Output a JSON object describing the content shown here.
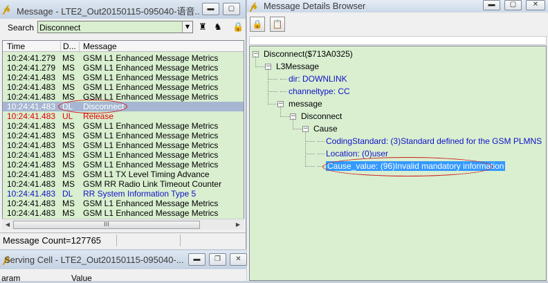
{
  "left_window": {
    "title": "Message - LTE2_Out20150115-095040-语音...",
    "search_label": "Search",
    "search_value": "Disconnect",
    "columns": [
      "Time",
      "D...",
      "Message"
    ],
    "rows": [
      {
        "time": "10:24:41.279",
        "dir": "MS",
        "msg": "GSM L1 Enhanced Message Metrics",
        "color": "#000000"
      },
      {
        "time": "10:24:41.279",
        "dir": "MS",
        "msg": "GSM L1 Enhanced Message Metrics",
        "color": "#000000"
      },
      {
        "time": "10:24:41.483",
        "dir": "MS",
        "msg": "GSM L1 Enhanced Message Metrics",
        "color": "#000000"
      },
      {
        "time": "10:24:41.483",
        "dir": "MS",
        "msg": "GSM L1 Enhanced Message Metrics",
        "color": "#000000"
      },
      {
        "time": "10:24:41.483",
        "dir": "MS",
        "msg": "GSM L1 Enhanced Message Metrics",
        "color": "#000000"
      },
      {
        "time": "10:24:41.483",
        "dir": "DL",
        "msg": "Disconnect",
        "color": "#ffffff"
      },
      {
        "time": "10:24:41.483",
        "dir": "UL",
        "msg": "Release",
        "color": "#e00000"
      },
      {
        "time": "10:24:41.483",
        "dir": "MS",
        "msg": "GSM L1 Enhanced Message Metrics",
        "color": "#000000"
      },
      {
        "time": "10:24:41.483",
        "dir": "MS",
        "msg": "GSM L1 Enhanced Message Metrics",
        "color": "#000000"
      },
      {
        "time": "10:24:41.483",
        "dir": "MS",
        "msg": "GSM L1 Enhanced Message Metrics",
        "color": "#000000"
      },
      {
        "time": "10:24:41.483",
        "dir": "MS",
        "msg": "GSM L1 Enhanced Message Metrics",
        "color": "#000000"
      },
      {
        "time": "10:24:41.483",
        "dir": "MS",
        "msg": "GSM L1 Enhanced Message Metrics",
        "color": "#000000"
      },
      {
        "time": "10:24:41.483",
        "dir": "MS",
        "msg": "GSM L1 TX Level Timing Advance",
        "color": "#000000"
      },
      {
        "time": "10:24:41.483",
        "dir": "MS",
        "msg": "GSM RR Radio Link Timeout Counter",
        "color": "#000000"
      },
      {
        "time": "10:24:41.483",
        "dir": "DL",
        "msg": "RR System Information Type 5",
        "color": "#1010c8"
      },
      {
        "time": "10:24:41.483",
        "dir": "MS",
        "msg": "GSM L1 Enhanced Message Metrics",
        "color": "#000000"
      },
      {
        "time": "10:24:41.483",
        "dir": "MS",
        "msg": "GSM L1 Enhanced Message Metrics",
        "color": "#000000"
      }
    ],
    "selected_row": 5,
    "scroll_thumb_glyph": "III",
    "status": "Message Count=127765"
  },
  "cell_window": {
    "title": "Serving Cell - LTE2_Out20150115-095040-...",
    "columns": [
      "aram",
      "Value"
    ]
  },
  "right_window": {
    "title": "Message Details Browser",
    "tree": [
      {
        "label": "Disconnect($713A0325)",
        "level": 0,
        "box": "−",
        "leaf": false
      },
      {
        "label": "L3Message",
        "level": 1,
        "box": "−",
        "leaf": false
      },
      {
        "label": "dir: DOWNLINK",
        "level": 2,
        "box": "",
        "leaf": true
      },
      {
        "label": "channeltype: CC",
        "level": 2,
        "box": "",
        "leaf": true
      },
      {
        "label": "message",
        "level": 2,
        "box": "−",
        "leaf": false
      },
      {
        "label": "Disconnect",
        "level": 3,
        "box": "−",
        "leaf": false
      },
      {
        "label": "Cause",
        "level": 4,
        "box": "−",
        "leaf": false
      },
      {
        "label": "CodingStandard: (3)Standard defined for the GSM PLMNS",
        "level": 5,
        "box": "",
        "leaf": true
      },
      {
        "label": "Location: (0)user",
        "level": 5,
        "box": "",
        "leaf": true
      },
      {
        "label": "Cause_value: (96)Invalid mandatory information",
        "level": 5,
        "box": "",
        "leaf": true,
        "selected": true
      }
    ]
  },
  "colors": {
    "list_background": "#d9efd0",
    "selection": "#3399ff",
    "annotation": "#d01818"
  }
}
